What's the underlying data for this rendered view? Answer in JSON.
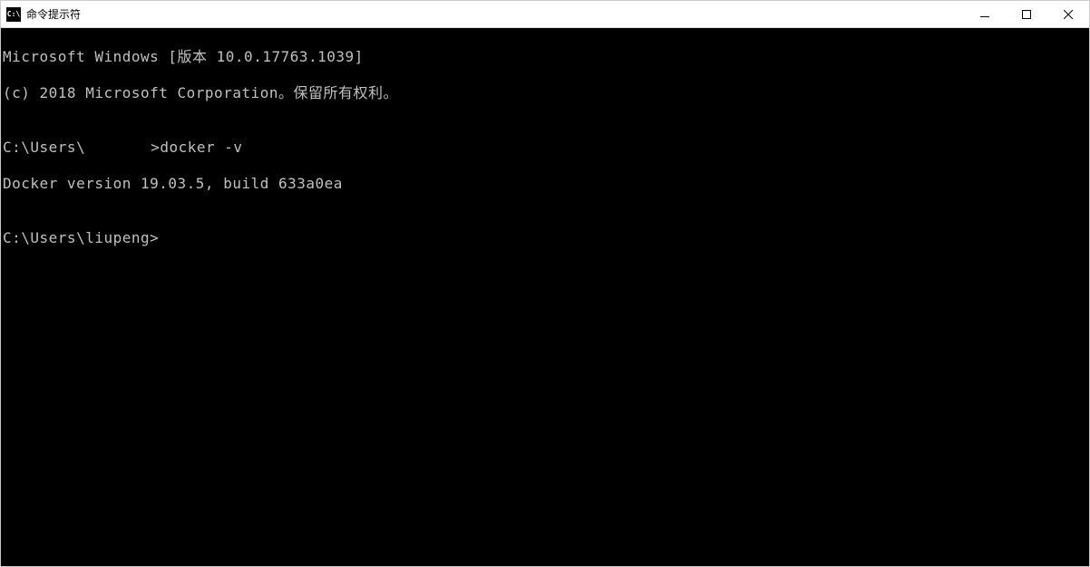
{
  "window": {
    "title": "命令提示符",
    "icon_label": "C:\\"
  },
  "terminal": {
    "line1": "Microsoft Windows [版本 10.0.17763.1039]",
    "line2": "(c) 2018 Microsoft Corporation。保留所有权利。",
    "line3": "",
    "prompt1_prefix": "C:\\Users\\",
    "prompt1_suffix": ">",
    "command1": "docker -v",
    "output1": "Docker version 19.03.5, build 633a0ea",
    "line_blank2": "",
    "prompt2": "C:\\Users\\liupeng>"
  }
}
